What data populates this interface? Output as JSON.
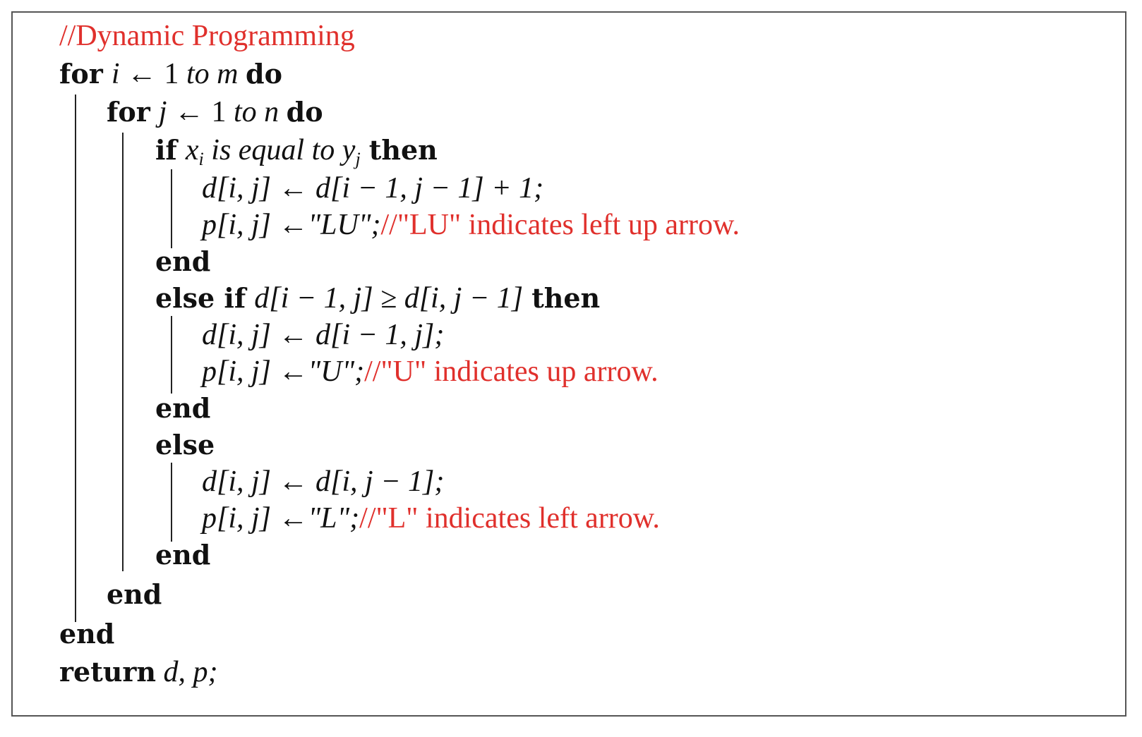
{
  "algorithm": {
    "comment_title": "//Dynamic Programming",
    "kw": {
      "for": "for",
      "do": "do",
      "if": "if",
      "then": "then",
      "end": "end",
      "else_if": "else if",
      "else": "else",
      "return": "return"
    },
    "lines": {
      "outer_loop_var": "i",
      "outer_loop_range_start": " ← 1 ",
      "outer_loop_to": "to",
      "outer_loop_end": " m ",
      "inner_loop_var": "j",
      "inner_loop_range_start": " ← 1 ",
      "inner_loop_to": "to",
      "inner_loop_end": " n ",
      "if_lhs": "x",
      "if_lhs_sub": "i",
      "if_text": " is equal to ",
      "if_rhs": "y",
      "if_rhs_sub": "j",
      "case1_d_assign": "d[i, j] ← d[i − 1, j − 1] + 1;",
      "case1_p_assign": "p[i, j] ←\"LU\";",
      "case1_comment": "//\"LU\" indicates left up arrow.",
      "elseif_cond": "d[i − 1, j] ≥ d[i, j − 1]",
      "case2_d_assign": "d[i, j] ← d[i − 1, j];",
      "case2_p_assign": "p[i, j] ←\"U\";",
      "case2_comment": "//\"U\" indicates up arrow.",
      "case3_d_assign": "d[i, j] ← d[i, j − 1];",
      "case3_p_assign": "p[i, j] ←\"L\";",
      "case3_comment": "//\"L\" indicates left arrow.",
      "return_value": " d, p;"
    }
  },
  "colors": {
    "comment": "#e0302c",
    "text": "#111111",
    "border": "#555555"
  }
}
